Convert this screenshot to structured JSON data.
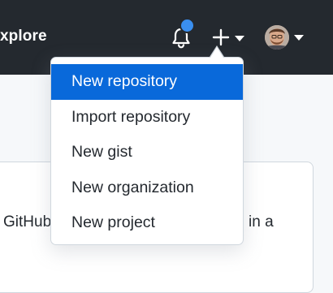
{
  "header": {
    "nav_label": "xplore",
    "icons": {
      "notifications": "bell-icon",
      "create": "plus-icon",
      "caret": "triangle-down-icon"
    },
    "colors": {
      "background": "#24292f",
      "notification_dot": "#3a8ff0"
    }
  },
  "create_menu": {
    "items": [
      {
        "label": "New repository",
        "active": true
      },
      {
        "label": "Import repository",
        "active": false
      },
      {
        "label": "New gist",
        "active": false
      },
      {
        "label": "New organization",
        "active": false
      },
      {
        "label": "New project",
        "active": false
      }
    ],
    "active_color": "#0969da"
  },
  "main": {
    "card_text_left": "GitHub",
    "card_text_right": "in a"
  }
}
